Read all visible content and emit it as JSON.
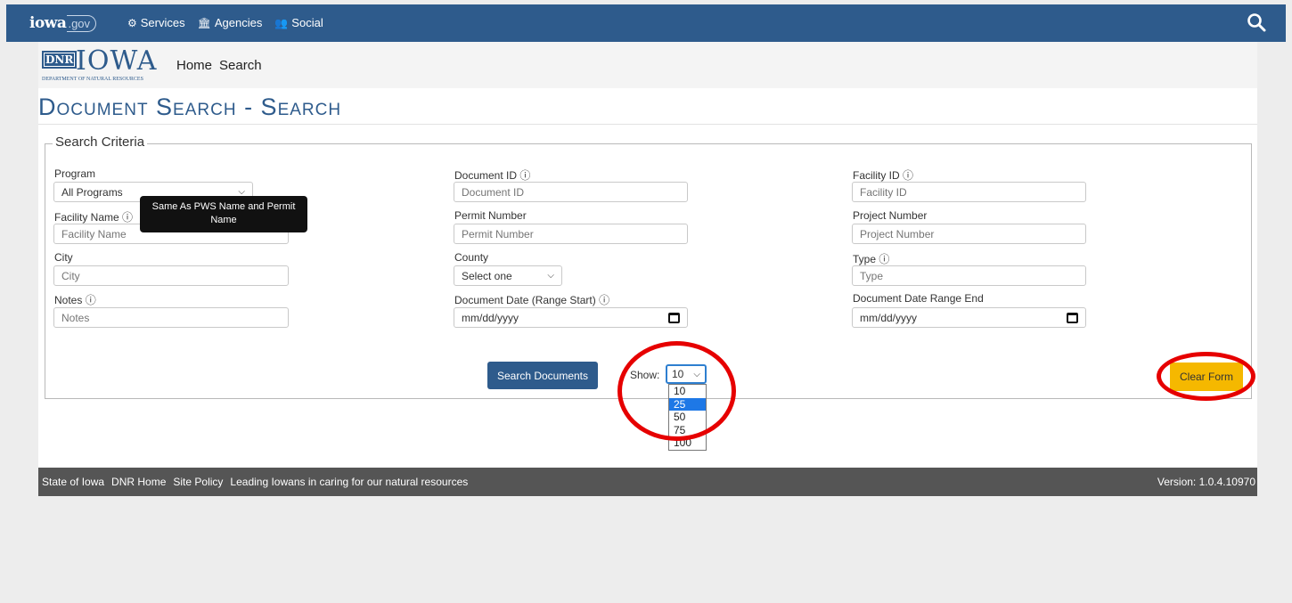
{
  "top_bar": {
    "logo_main": "iowa",
    "logo_suffix": ".gov",
    "nav": [
      {
        "label": "Services",
        "icon": "gears-icon"
      },
      {
        "label": "Agencies",
        "icon": "building-icon"
      },
      {
        "label": "Social",
        "icon": "people-icon"
      }
    ],
    "search_icon": "search-icon"
  },
  "brand": {
    "dnr_mark": "DNR",
    "iowa_word": "IOWA",
    "department": "DEPARTMENT OF NATURAL RESOURCES",
    "nav": [
      "Home",
      "Search"
    ]
  },
  "page_title": "Document Search - Search",
  "criteria": {
    "legend": "Search Criteria",
    "info_glyph": "ⓘ",
    "program": {
      "label": "Program",
      "value": "All Programs"
    },
    "document_id": {
      "label": "Document ID",
      "placeholder": "Document ID"
    },
    "facility_id": {
      "label": "Facility ID",
      "placeholder": "Facility ID"
    },
    "facility_name": {
      "label": "Facility Name",
      "placeholder": "Facility Name"
    },
    "permit_number": {
      "label": "Permit Number",
      "placeholder": "Permit Number"
    },
    "project_number": {
      "label": "Project Number",
      "placeholder": "Project Number"
    },
    "city": {
      "label": "City",
      "placeholder": "City"
    },
    "county": {
      "label": "County",
      "value": "Select one"
    },
    "type": {
      "label": "Type",
      "placeholder": "Type"
    },
    "notes": {
      "label": "Notes",
      "placeholder": "Notes"
    },
    "date_start": {
      "label": "Document Date (Range Start)",
      "value": "mm/dd/yyyy"
    },
    "date_end": {
      "label": "Document Date Range End",
      "value": "mm/dd/yyyy"
    },
    "tooltip": "Same As PWS Name and Permit Name"
  },
  "actions": {
    "search_label": "Search Documents",
    "show_label": "Show:",
    "show_value": "10",
    "show_options": [
      "10",
      "25",
      "50",
      "75",
      "100"
    ],
    "highlighted_option": "25",
    "clear_label": "Clear Form"
  },
  "footer": {
    "links": [
      "State of Iowa",
      "DNR Home",
      "Site Policy"
    ],
    "tagline": "Leading Iowans in caring for our natural resources",
    "version": "Version: 1.0.4.10970"
  },
  "colors": {
    "brand_blue": "#2e5b8c",
    "accent_yellow": "#f5b800",
    "annotation_red": "#e60000",
    "footer_gray": "#555555"
  }
}
